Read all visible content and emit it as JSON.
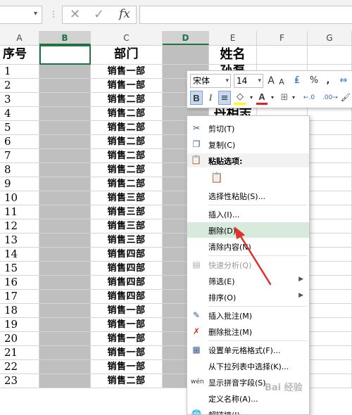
{
  "formula_bar": {
    "name_box_arrow": "▾",
    "separator": "⋮",
    "cancel": "✕",
    "enter": "✓",
    "fx": "fx",
    "value": ""
  },
  "columns": [
    "A",
    "B",
    "C",
    "D",
    "E",
    "F",
    "G"
  ],
  "selected_columns": [
    "B",
    "D"
  ],
  "header_row": {
    "a": "序号",
    "b": "",
    "c": "部门",
    "d": "",
    "e": "姓名"
  },
  "rows": [
    {
      "a": "1",
      "c": "销售一部",
      "e": "孙磊"
    },
    {
      "a": "2",
      "c": "销售一部",
      "e": ""
    },
    {
      "a": "3",
      "c": "销售二部",
      "e": ""
    },
    {
      "a": "4",
      "c": "销售二部",
      "e": "丹相志"
    },
    {
      "a": "5",
      "c": "销售二部",
      "e": ""
    },
    {
      "a": "6",
      "c": "销售二部",
      "e": ""
    },
    {
      "a": "7",
      "c": "销售二部",
      "e": ""
    },
    {
      "a": "8",
      "c": "销售二部",
      "e": ""
    },
    {
      "a": "9",
      "c": "销售二部",
      "e": ""
    },
    {
      "a": "10",
      "c": "销售三部",
      "e": ""
    },
    {
      "a": "11",
      "c": "销售三部",
      "e": ""
    },
    {
      "a": "12",
      "c": "销售三部",
      "e": ""
    },
    {
      "a": "13",
      "c": "销售三部",
      "e": ""
    },
    {
      "a": "14",
      "c": "销售四部",
      "e": ""
    },
    {
      "a": "15",
      "c": "销售四部",
      "e": ""
    },
    {
      "a": "16",
      "c": "销售四部",
      "e": ""
    },
    {
      "a": "17",
      "c": "销售四部",
      "e": ""
    },
    {
      "a": "18",
      "c": "销售一部",
      "e": ""
    },
    {
      "a": "19",
      "c": "销售一部",
      "e": ""
    },
    {
      "a": "20",
      "c": "销售一部",
      "e": ""
    },
    {
      "a": "21",
      "c": "销售一部",
      "e": ""
    },
    {
      "a": "22",
      "c": "销售一部",
      "e": ""
    },
    {
      "a": "23",
      "c": "销售二部",
      "e": ""
    }
  ],
  "mini_toolbar": {
    "font": "宋体",
    "size": "14",
    "grow_font": "A",
    "shrink_font": "A",
    "accounting": "₤",
    "percent": "%",
    "comma": ",",
    "bold": "B",
    "italic": "I",
    "align_center": "≡",
    "fill_color": "◇",
    "font_color": "A",
    "borders": "⊞",
    "increase_decimal": "←.0",
    "decrease_decimal": ".00→",
    "format_painter": "🖌",
    "font_color_hex": "#e02020",
    "fill_color_hex": "#ffff00"
  },
  "context_menu": {
    "cut": "剪切(T)",
    "copy": "复制(C)",
    "paste_options_header": "粘贴选项:",
    "paste_special": "选择性粘贴(S)...",
    "insert": "插入(I)...",
    "delete": "删除(D)...",
    "clear_contents": "清除内容(N)",
    "quick_analysis": "快速分析(Q)",
    "filter": "筛选(E)",
    "sort": "排序(O)",
    "insert_comment": "插入批注(M)",
    "delete_comment": "删除批注(M)",
    "format_cells": "设置单元格格式(F)...",
    "pick_from_list": "从下拉列表中选择(K)...",
    "phonetic": "显示拼音字段(S)",
    "define_name": "定义名称(A)...",
    "hyperlink": "超链接(I)...",
    "submenu_arrow": "▶",
    "highlight_color": "#d7eadb"
  },
  "watermark": "Bai 经验"
}
